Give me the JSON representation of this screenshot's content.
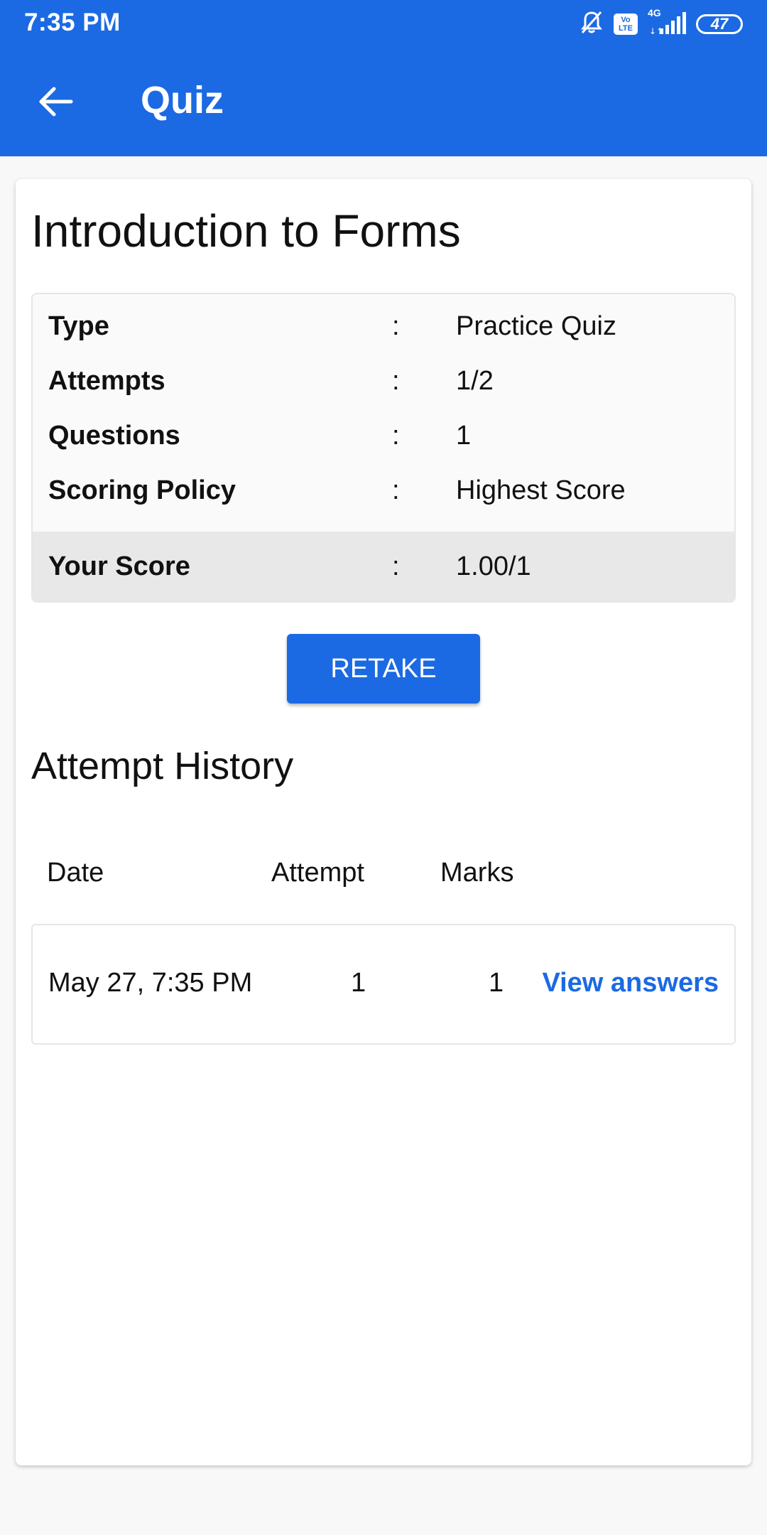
{
  "status_bar": {
    "time": "7:35 PM",
    "volte_line1": "Vo",
    "volte_line2": "LTE",
    "network": "4G",
    "battery": "47"
  },
  "app_bar": {
    "title": "Quiz"
  },
  "quiz": {
    "title": "Introduction to Forms",
    "info": [
      {
        "label": "Type",
        "separator": ":",
        "value": "Practice Quiz"
      },
      {
        "label": "Attempts",
        "separator": ":",
        "value": "1/2"
      },
      {
        "label": "Questions",
        "separator": ":",
        "value": "1"
      },
      {
        "label": "Scoring Policy",
        "separator": ":",
        "value": "Highest Score"
      }
    ],
    "score": {
      "label": "Your Score",
      "separator": ":",
      "value": "1.00/1"
    },
    "retake_label": "RETAKE"
  },
  "history": {
    "title": "Attempt History",
    "columns": [
      "Date",
      "Attempt",
      "Marks"
    ],
    "rows": [
      {
        "date": "May 27, 7:35 PM",
        "attempt": "1",
        "marks": "1",
        "action": "View answers"
      }
    ]
  },
  "colors": {
    "primary": "#1b6ae3",
    "background": "#f8f8f8",
    "score_row": "#e8e8e8"
  }
}
